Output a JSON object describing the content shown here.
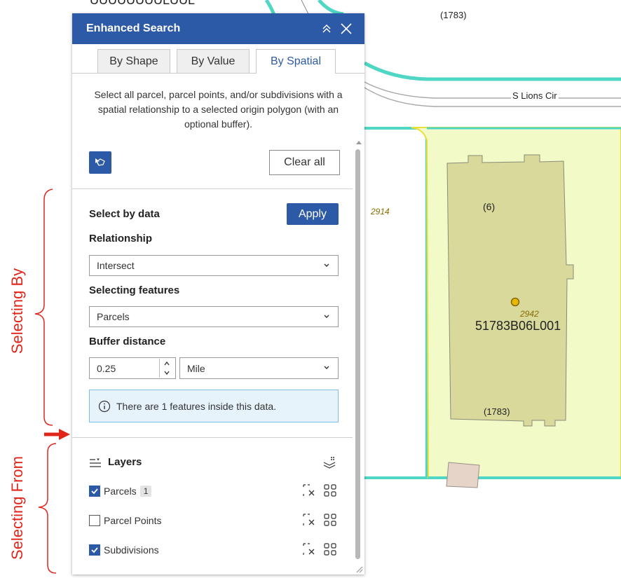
{
  "map": {
    "street_label": "S Lions Cir",
    "top_number": "(1783)",
    "lot_number": "(6)",
    "parcel_id": "51783B06L001",
    "address_top": "2942",
    "address_left": "2914",
    "lot_bottom": "(1783)",
    "top_cut_text": "UUUUUUUULUUL"
  },
  "panel": {
    "title": "Enhanced Search",
    "tabs": [
      {
        "label": "By Shape",
        "active": false
      },
      {
        "label": "By Value",
        "active": false
      },
      {
        "label": "By Spatial",
        "active": true
      }
    ],
    "description": "Select all parcel, parcel points, and/or subdivisions with a spatial relationship to a selected origin polygon (with an optional buffer).",
    "clear_all_label": "Clear all",
    "select_by_data": {
      "title": "Select by data",
      "apply_label": "Apply",
      "relationship_label": "Relationship",
      "relationship_value": "Intersect",
      "selecting_features_label": "Selecting features",
      "selecting_features_value": "Parcels",
      "buffer_label": "Buffer distance",
      "buffer_value": "0.25",
      "buffer_unit": "Mile",
      "info_message": "There are 1 features inside this data."
    },
    "layers": {
      "title": "Layers",
      "items": [
        {
          "label": "Parcels",
          "checked": true,
          "count": "1"
        },
        {
          "label": "Parcel Points",
          "checked": false
        },
        {
          "label": "Subdivisions",
          "checked": true
        }
      ]
    }
  },
  "annotations": {
    "selecting_by": "Selecting By",
    "selecting_from": "Selecting From"
  },
  "colors": {
    "accent": "#2d5aa7",
    "parcel_fill": "#d8d99a",
    "highlight_fill": "#f2fbc8",
    "outline_teal": "#4fd6c4",
    "annotation_red": "#e0261b",
    "info_bg": "#e6f3fb"
  }
}
